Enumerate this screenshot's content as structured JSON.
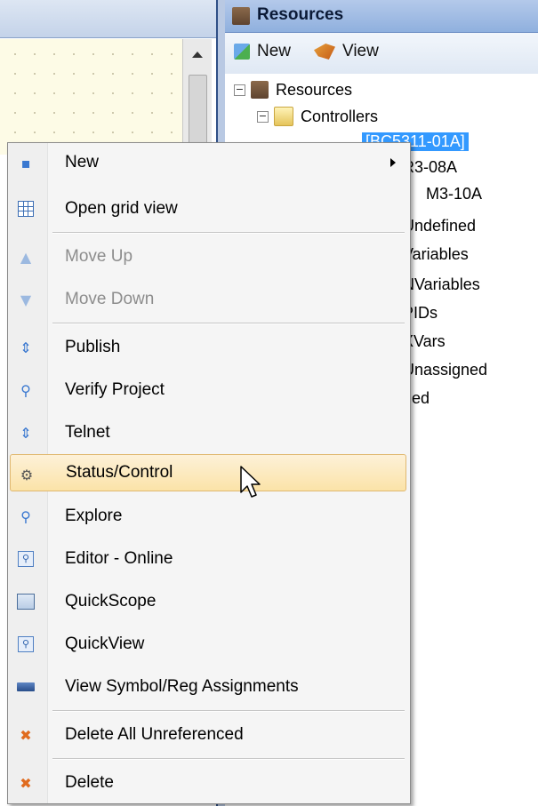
{
  "resources_panel": {
    "title": "Resources",
    "toolbar": {
      "new_label": "New",
      "view_label": "View"
    },
    "tree": {
      "root_label": "Resources",
      "controllers_label": "Controllers",
      "selected_label": "[BC5311-01A]",
      "partial_rows": [
        "R3-08A",
        "M3-10A",
        "Undefined",
        "Variables",
        "NVariables",
        "PIDs",
        "XVars",
        "Unassigned",
        "ned"
      ]
    }
  },
  "context_menu": {
    "items": [
      {
        "label": "New",
        "icon": "new-icon",
        "has_submenu": true,
        "enabled": true
      },
      {
        "label": "Open grid view",
        "icon": "grid-icon",
        "enabled": true
      },
      {
        "label": "Move Up",
        "icon": "arrow-up-icon",
        "enabled": false
      },
      {
        "label": "Move Down",
        "icon": "arrow-down-icon",
        "enabled": false
      },
      {
        "label": "Publish",
        "icon": "publish-icon",
        "enabled": true
      },
      {
        "label": "Verify Project",
        "icon": "magnifier-icon",
        "enabled": true
      },
      {
        "label": "Telnet",
        "icon": "telnet-icon",
        "enabled": true
      },
      {
        "label": "Status/Control",
        "icon": "gear-icon",
        "enabled": true,
        "highlighted": true
      },
      {
        "label": "Explore",
        "icon": "magnifier-icon",
        "enabled": true
      },
      {
        "label": "Editor - Online",
        "icon": "zoom-box-icon",
        "enabled": true
      },
      {
        "label": "QuickScope",
        "icon": "scope-icon",
        "enabled": true
      },
      {
        "label": "QuickView",
        "icon": "zoom-box-icon",
        "enabled": true
      },
      {
        "label": "View Symbol/Reg Assignments",
        "icon": "card-icon",
        "enabled": true
      },
      {
        "label": "Delete All Unreferenced",
        "icon": "delete-x-icon",
        "enabled": true
      },
      {
        "label": "Delete",
        "icon": "delete-x-icon",
        "enabled": true
      }
    ]
  },
  "colors": {
    "selection_blue": "#3399ff",
    "menu_highlight": "#fbe3a8",
    "header_blue": "#8fb0de"
  }
}
